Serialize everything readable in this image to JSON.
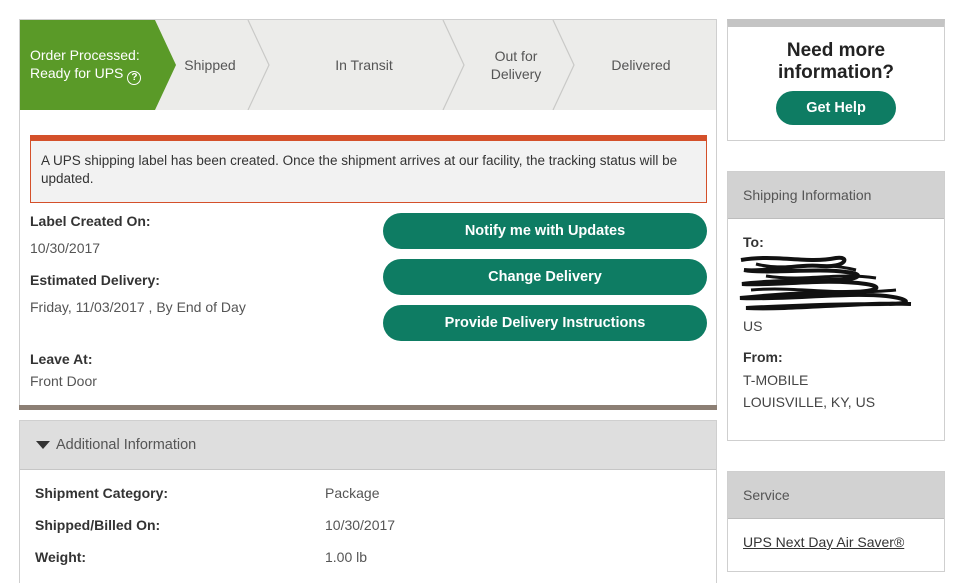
{
  "progress": {
    "steps": [
      {
        "label_line1": "Order Processed:",
        "label_line2": "Ready for UPS",
        "active": true
      },
      {
        "label": "Shipped"
      },
      {
        "label": "In Transit"
      },
      {
        "label_line1": "Out for",
        "label_line2": "Delivery"
      },
      {
        "label": "Delivered"
      }
    ],
    "help_icon": "question-circle-icon",
    "active_color": "#5a9a28"
  },
  "alert": {
    "text": "A UPS shipping label has been created. Once the shipment arrives at our facility, the tracking status will be updated.",
    "color": "#d4502a"
  },
  "details": {
    "label_created_label": "Label Created On:",
    "label_created_value": "10/30/2017",
    "est_delivery_label": "Estimated Delivery:",
    "est_delivery_value": "Friday, 11/03/2017 , By End of Day",
    "leave_at_label": "Leave At:",
    "leave_at_value": "Front Door"
  },
  "actions": {
    "notify": "Notify me with Updates",
    "change": "Change Delivery",
    "instructions": "Provide Delivery Instructions",
    "color": "#0e7c63"
  },
  "additional": {
    "header": "Additional Information",
    "rows": [
      {
        "label": "Shipment Category:",
        "value": "Package"
      },
      {
        "label": "Shipped/Billed On:",
        "value": "10/30/2017"
      },
      {
        "label": "Weight:",
        "value": "1.00 lb"
      }
    ]
  },
  "help": {
    "title_line1": "Need more",
    "title_line2": "information?",
    "button": "Get Help"
  },
  "shipping": {
    "header": "Shipping Information",
    "to_label": "To:",
    "to_country": "US",
    "from_label": "From:",
    "from_name": "T-MOBILE",
    "from_address": "LOUISVILLE,  KY,  US"
  },
  "service": {
    "header": "Service",
    "value": "UPS Next Day Air Saver®"
  }
}
